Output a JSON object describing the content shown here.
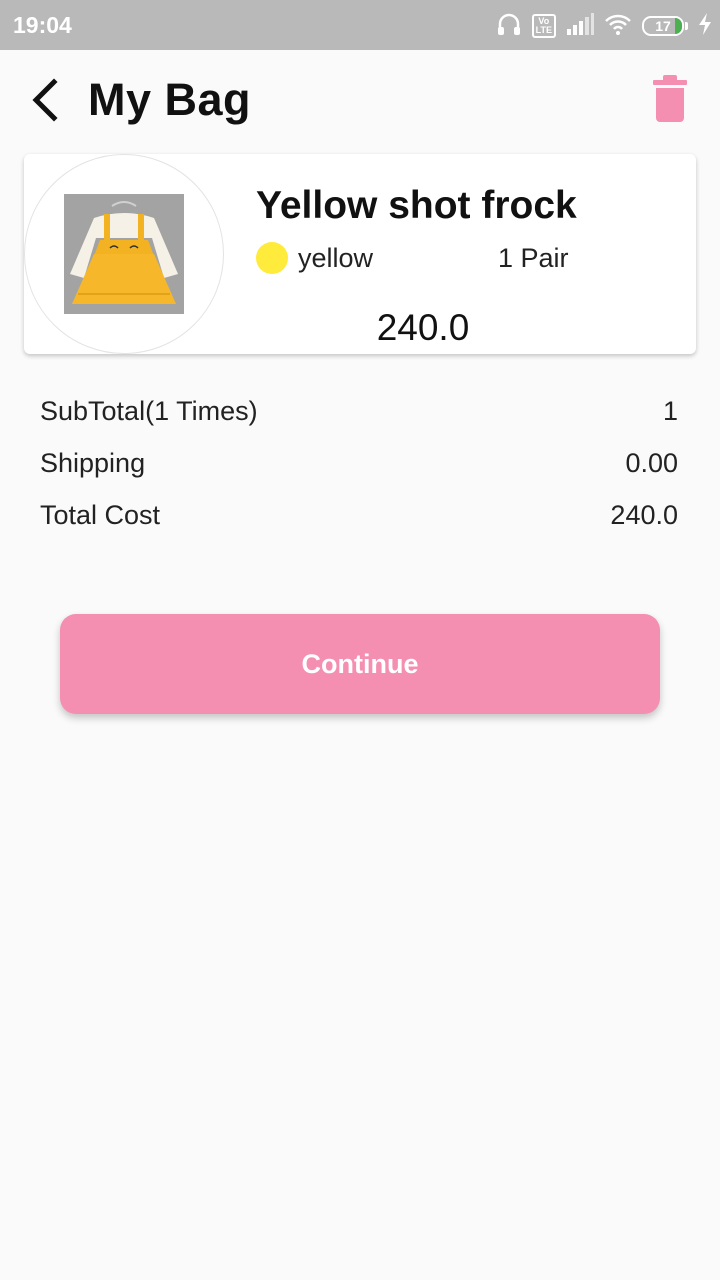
{
  "status_bar": {
    "time": "19:04",
    "icons": [
      "headphones-icon",
      "volte-icon",
      "signal-icon",
      "wifi-icon",
      "battery-icon",
      "charging-icon"
    ],
    "volte_top": "Vo",
    "volte_bottom": "LTE",
    "battery_level": "17"
  },
  "app_bar": {
    "title": "My Bag",
    "back_icon": "chevron-left-icon",
    "delete_icon": "trash-icon"
  },
  "cart_item": {
    "name": "Yellow shot frock",
    "color_name": "yellow",
    "quantity": "1 Pair",
    "price": "240.0"
  },
  "summary": {
    "rows": [
      {
        "label": "SubTotal(1 Times)",
        "value": "1"
      },
      {
        "label": "Shipping",
        "value": "0.00"
      },
      {
        "label": "Total Cost",
        "value": "240.0"
      }
    ]
  },
  "actions": {
    "continue_label": "Continue"
  },
  "colors": {
    "accent": "#f48fb1",
    "swatch_yellow": "#ffeb3b",
    "status_bar": "#b9b9b9"
  }
}
